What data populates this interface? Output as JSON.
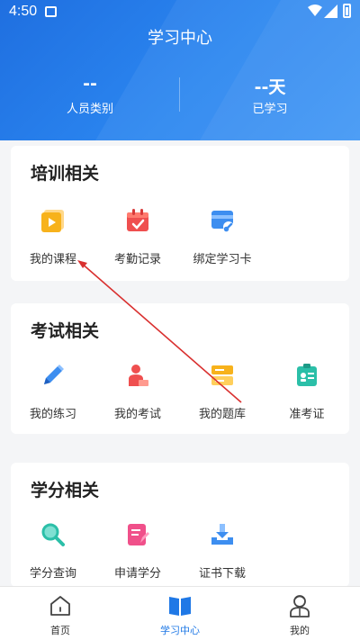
{
  "status_bar": {
    "time": "4:50"
  },
  "header": {
    "title": "学习中心",
    "stats": [
      {
        "value": "--",
        "label": "人员类别"
      },
      {
        "value": "--天",
        "label": "已学习"
      }
    ]
  },
  "sections": {
    "training": {
      "title": "培训相关",
      "items": [
        {
          "label": "我的课程",
          "icon": "video-play-icon"
        },
        {
          "label": "考勤记录",
          "icon": "calendar-check-icon"
        },
        {
          "label": "绑定学习卡",
          "icon": "card-bind-icon"
        }
      ]
    },
    "exam": {
      "title": "考试相关",
      "items": [
        {
          "label": "我的练习",
          "icon": "pencil-icon"
        },
        {
          "label": "我的考试",
          "icon": "exam-person-icon"
        },
        {
          "label": "我的题库",
          "icon": "question-bank-icon"
        },
        {
          "label": "准考证",
          "icon": "admission-ticket-icon"
        }
      ]
    },
    "credit": {
      "title": "学分相关",
      "items": [
        {
          "label": "学分查询",
          "icon": "search-icon"
        },
        {
          "label": "申请学分",
          "icon": "apply-form-icon"
        },
        {
          "label": "证书下载",
          "icon": "download-icon"
        }
      ]
    }
  },
  "tabbar": [
    {
      "label": "首页",
      "icon": "home-icon",
      "active": false
    },
    {
      "label": "学习中心",
      "icon": "book-icon",
      "active": true
    },
    {
      "label": "我的",
      "icon": "user-icon",
      "active": false
    }
  ],
  "colors": {
    "header_blue": "#1f6fe0",
    "active_tab": "#1f78e6",
    "annotation_red": "#d9302f"
  }
}
